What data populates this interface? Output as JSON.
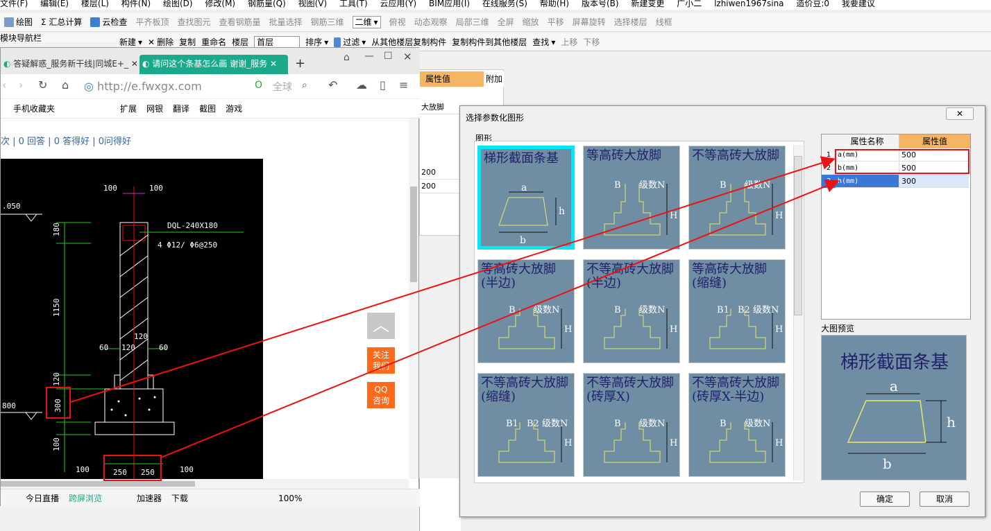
{
  "app": {
    "menu": [
      "文件(F)",
      "编辑(E)",
      "楼层(L)",
      "构件(N)",
      "绘图(D)",
      "修改(M)",
      "钢筋量(Q)",
      "视图(V)",
      "工具(T)",
      "云应用(Y)",
      "BIM应用(I)",
      "在线服务(S)",
      "帮助(H)",
      "版本号(B)",
      "新建变更",
      "广小二",
      "lzhiwen1967sina",
      "造价豆:0",
      "我要建议"
    ],
    "toolbar1": [
      "绘图",
      "Σ 汇总计算",
      "云检查",
      "平齐板顶",
      "查找图元",
      "查看钢筋量",
      "批量选择",
      "钢筋三维",
      "二维",
      "俯视",
      "动态观察",
      "局部三维",
      "全屏",
      "缩放",
      "平移",
      "屏幕旋转",
      "选择楼层",
      "线框"
    ],
    "toolbar2": [
      "新建",
      "删除",
      "复制",
      "重命名",
      "楼层",
      "首层",
      "排序",
      "过滤",
      "从其他楼层复制构件",
      "复制构件到其他楼层",
      "查找",
      "上移",
      "下移"
    ],
    "nav_panel_title": "模块导航栏",
    "prop_header": "属性值",
    "prop_header2": "附加",
    "prop_cells": [
      "大放脚",
      "200",
      "200"
    ]
  },
  "browser": {
    "tab1_label": "答疑解惑_服务新干线|同城E+_",
    "tab2_label": "请问这个条基怎么画 谢谢_服务",
    "url": "http://e.fwxgx.com",
    "search_placeholder": "全球",
    "bookmarks": [
      "手机收藏夹",
      "扩展",
      "网银",
      "翻译",
      "截图",
      "游戏"
    ],
    "page_stats": "次 | 0 回答 | 0 答得好 | 0问得好",
    "side_buttons": [
      "关注\n我们",
      "QQ\n咨询"
    ],
    "status_items": [
      "今日直播",
      "跨屏浏览",
      "加速器",
      "下载",
      "100%"
    ],
    "cad_labels": {
      "dim_top_left": "100",
      "dim_top_right": "100",
      "elev1": ".050",
      "elev2": "800",
      "beam": "DQL-240X180",
      "rebar": "4 Φ12/   Φ6@250",
      "v180": "180",
      "v1150": "1150",
      "v120": "120",
      "v300": "300",
      "v100": "100",
      "h60a": "60",
      "h120": "120",
      "h60b": "60",
      "h120b": "120",
      "b100l": "100",
      "b250a": "250",
      "b250b": "250",
      "b100r": "100"
    }
  },
  "dialog": {
    "title": "选择参数化图形",
    "group": "图形",
    "shapes": [
      "梯形截面条基",
      "等高砖大放脚",
      "不等高砖大放脚",
      "等高砖大放脚(半边)",
      "不等高砖大放脚(半边)",
      "等高砖大放脚(缩缝)",
      "不等高砖大放脚(缩缝)",
      "不等高砖大放脚(砖厚X)",
      "不等高砖大放脚(砖厚X-半边)"
    ],
    "shape_letters": {
      "a": "a",
      "b": "b",
      "h": "h",
      "B": "B",
      "N": "级数N",
      "H": "H",
      "B1": "B1",
      "B2": "B2"
    },
    "table_headers": [
      "属性名称",
      "属性值"
    ],
    "rows": [
      {
        "no": "1",
        "name": "a(mm)",
        "value": "500"
      },
      {
        "no": "2",
        "name": "b(mm)",
        "value": "500"
      },
      {
        "no": "3",
        "name": "h(mm)",
        "value": "300"
      }
    ],
    "preview_label": "大图预览",
    "preview_title": "梯形截面条基",
    "ok": "确定",
    "cancel": "取消"
  },
  "colors": {
    "accent_red": "#e11111",
    "thumb_bg": "#6f8ea3",
    "selected_border": "#00e8f8",
    "header_orange": "#f5b562",
    "tab_green": "#1aa98a"
  }
}
